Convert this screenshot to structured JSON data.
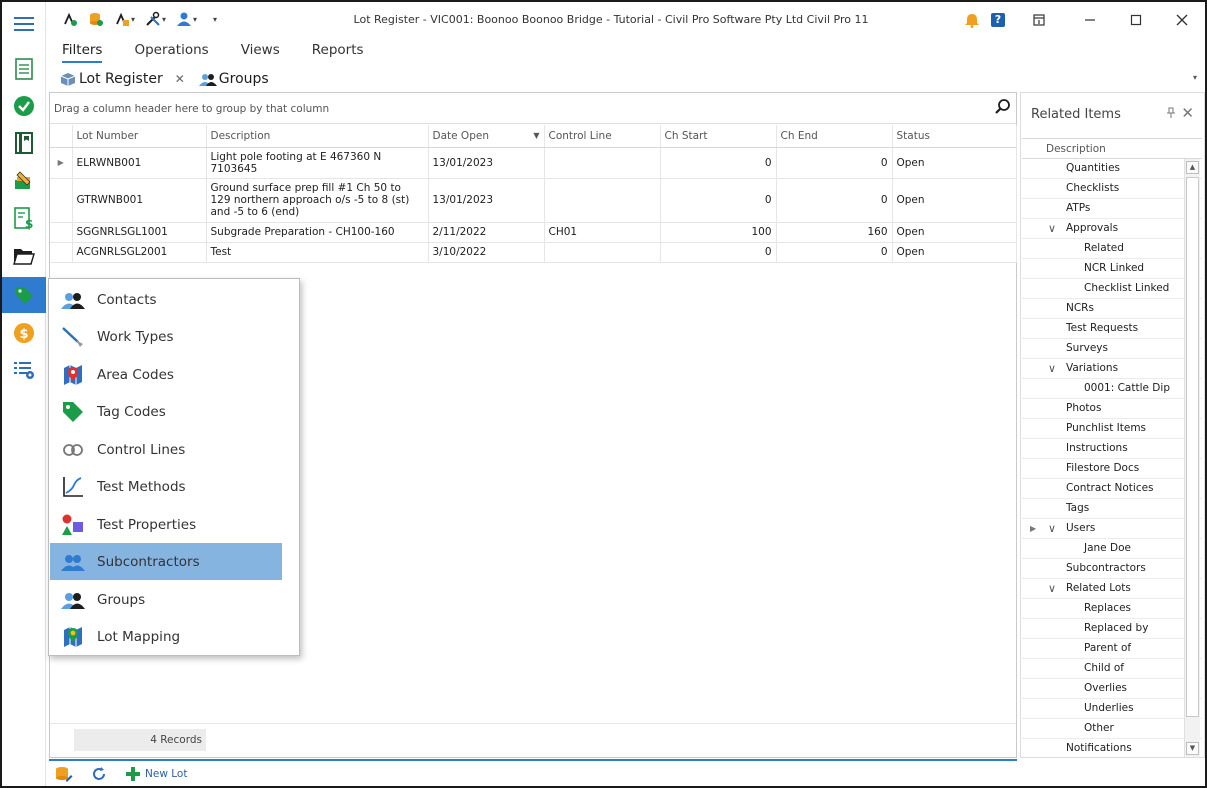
{
  "window": {
    "title": "Lot Register - VIC001: Boonoo Boonoo Bridge - Tutorial - Civil Pro Software Pty Ltd Civil Pro 11",
    "quick_access_icons": [
      "lot-tools-icon",
      "database-icon",
      "lot-menu-icon",
      "tools-icon",
      "user-icon",
      "customize-icon"
    ],
    "controls": [
      "notification-bell-icon",
      "help-icon",
      "restore-layout-icon",
      "minimize-icon",
      "maximize-icon",
      "close-icon"
    ],
    "help_glyph": "?"
  },
  "ribbon": {
    "tabs": [
      {
        "label": "Filters",
        "active": true
      },
      {
        "label": "Operations",
        "active": false
      },
      {
        "label": "Views",
        "active": false
      },
      {
        "label": "Reports",
        "active": false
      }
    ]
  },
  "doc_tabs": [
    {
      "label": "Lot Register",
      "closable": true
    },
    {
      "label": "Groups",
      "closable": false
    }
  ],
  "grid": {
    "group_hint": "Drag a column header here to group by that column",
    "columns": [
      "Lot Number",
      "Description",
      "Date Open",
      "Control Line",
      "Ch Start",
      "Ch End",
      "Status"
    ],
    "rows": [
      {
        "lot": "ELRWNB001",
        "description": "Light pole footing at E 467360 N 7103645",
        "date_open": "13/01/2023",
        "control_line": "",
        "ch_start": "0",
        "ch_end": "0",
        "status": "Open"
      },
      {
        "lot": "GTRWNB001",
        "description": "Ground surface prep fill #1 Ch 50 to 129 northern approach o/s -5 to 8 (st) and -5 to 6 (end)",
        "date_open": "13/01/2023",
        "control_line": "",
        "ch_start": "0",
        "ch_end": "0",
        "status": "Open"
      },
      {
        "lot": "SGGNRLSGL1001",
        "description": "Subgrade Preparation - CH100-160",
        "date_open": "2/11/2022",
        "control_line": "CH01",
        "ch_start": "100",
        "ch_end": "160",
        "status": "Open"
      },
      {
        "lot": "ACGNRLSGL2001",
        "description": "Test",
        "date_open": "3/10/2022",
        "control_line": "",
        "ch_start": "0",
        "ch_end": "0",
        "status": "Open"
      }
    ],
    "record_count": "4 Records"
  },
  "bottom_toolbar": {
    "new_lot_label": "New Lot"
  },
  "flyout": {
    "items": [
      {
        "label": "Contacts",
        "icon": "contacts-icon"
      },
      {
        "label": "Work Types",
        "icon": "work-types-icon"
      },
      {
        "label": "Area Codes",
        "icon": "area-codes-icon"
      },
      {
        "label": "Tag Codes",
        "icon": "tag-codes-icon"
      },
      {
        "label": "Control Lines",
        "icon": "control-lines-icon"
      },
      {
        "label": "Test Methods",
        "icon": "test-methods-icon"
      },
      {
        "label": "Test Properties",
        "icon": "test-properties-icon"
      },
      {
        "label": "Subcontractors",
        "icon": "subcontractors-icon",
        "highlighted": true
      },
      {
        "label": "Groups",
        "icon": "groups-icon"
      },
      {
        "label": "Lot Mapping",
        "icon": "lot-mapping-icon"
      }
    ]
  },
  "related": {
    "title": "Related Items",
    "column_header": "Description",
    "items": [
      {
        "label": "Quantities",
        "level": 0
      },
      {
        "label": "Checklists",
        "level": 0
      },
      {
        "label": "ATPs",
        "level": 0
      },
      {
        "label": "Approvals",
        "level": 0,
        "expanded": true
      },
      {
        "label": "Related",
        "level": 1
      },
      {
        "label": "NCR Linked",
        "level": 1
      },
      {
        "label": "Checklist Linked",
        "level": 1
      },
      {
        "label": "NCRs",
        "level": 0
      },
      {
        "label": "Test Requests",
        "level": 0
      },
      {
        "label": "Surveys",
        "level": 0
      },
      {
        "label": "Variations",
        "level": 0,
        "expanded": true
      },
      {
        "label": "0001: Cattle Dip",
        "level": 1
      },
      {
        "label": "Photos",
        "level": 0
      },
      {
        "label": "Punchlist Items",
        "level": 0
      },
      {
        "label": "Instructions",
        "level": 0
      },
      {
        "label": "Filestore Docs",
        "level": 0
      },
      {
        "label": "Contract Notices",
        "level": 0
      },
      {
        "label": "Tags",
        "level": 0
      },
      {
        "label": "Users",
        "level": 0,
        "expanded": true,
        "current": true
      },
      {
        "label": "Jane Doe",
        "level": 1
      },
      {
        "label": "Subcontractors",
        "level": 0
      },
      {
        "label": "Related Lots",
        "level": 0,
        "expanded": true
      },
      {
        "label": "Replaces",
        "level": 1
      },
      {
        "label": "Replaced by",
        "level": 1
      },
      {
        "label": "Parent of",
        "level": 1
      },
      {
        "label": "Child of",
        "level": 1
      },
      {
        "label": "Overlies",
        "level": 1
      },
      {
        "label": "Underlies",
        "level": 1
      },
      {
        "label": "Other",
        "level": 1
      },
      {
        "label": "Notifications",
        "level": 0
      }
    ]
  },
  "rail": {
    "icons": [
      "menu-icon",
      "lot-register-icon",
      "approved-icon",
      "notebook-icon",
      "edit-docs-icon",
      "claims-icon",
      "folder-icon",
      "tags-icon",
      "money-icon",
      "settings-table-icon"
    ],
    "active": "tags-icon"
  },
  "colors": {
    "accent": "#2e7bd0",
    "highlight": "#86b4e0",
    "green": "#1a9c48",
    "orange": "#f0a020"
  }
}
